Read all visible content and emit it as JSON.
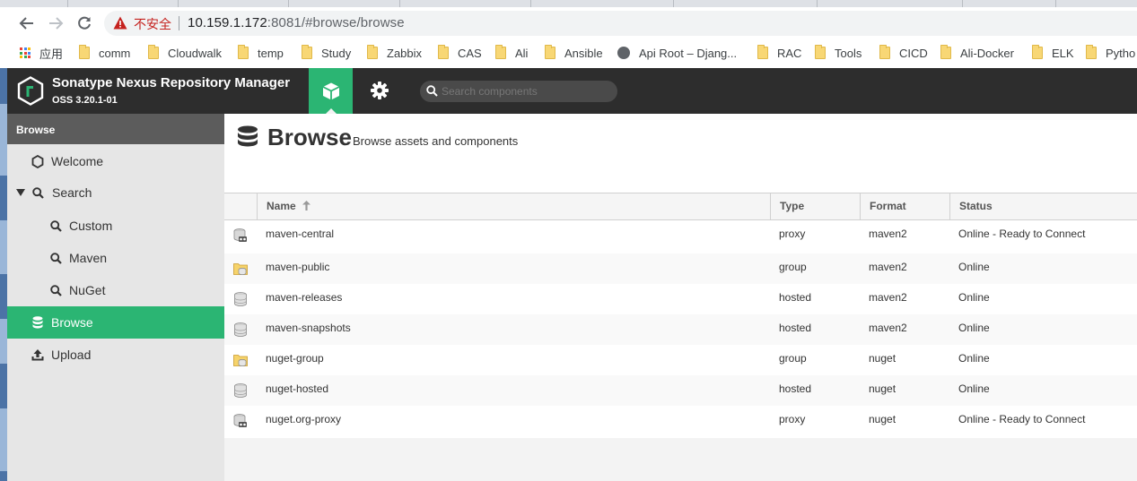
{
  "browser": {
    "address_security": "不安全",
    "url_host": "10.159.1.172",
    "url_rest": ":8081/#browse/browse",
    "bookmarks": [
      "应用",
      "comm",
      "Cloudwalk",
      "temp",
      "Study",
      "Zabbix",
      "CAS",
      "Ali",
      "Ansible",
      "Api Root – Djang...",
      "RAC",
      "Tools",
      "CICD",
      "Ali-Docker",
      "ELK",
      "Pytho"
    ]
  },
  "header": {
    "title": "Sonatype Nexus Repository Manager",
    "version": "OSS 3.20.1-01",
    "search_placeholder": "Search components",
    "accent": "#2bb573"
  },
  "sidebar": {
    "heading": "Browse",
    "items": [
      {
        "label": "Welcome",
        "icon": "hexagon-icon"
      },
      {
        "label": "Search",
        "icon": "search-icon",
        "expanded": true
      },
      {
        "label": "Custom",
        "icon": "search-icon"
      },
      {
        "label": "Maven",
        "icon": "search-icon"
      },
      {
        "label": "NuGet",
        "icon": "search-icon"
      },
      {
        "label": "Browse",
        "icon": "database-icon",
        "active": true
      },
      {
        "label": "Upload",
        "icon": "upload-icon"
      }
    ]
  },
  "page": {
    "title": "Browse",
    "subtitle": "Browse assets and components"
  },
  "table": {
    "columns": [
      "Name",
      "Type",
      "Format",
      "Status"
    ],
    "sort_column": "Name",
    "sort_direction": "ascending",
    "rows": [
      {
        "name": "maven-central",
        "type": "proxy",
        "format": "maven2",
        "status": "Online - Ready to Connect"
      },
      {
        "name": "maven-public",
        "type": "group",
        "format": "maven2",
        "status": "Online"
      },
      {
        "name": "maven-releases",
        "type": "hosted",
        "format": "maven2",
        "status": "Online"
      },
      {
        "name": "maven-snapshots",
        "type": "hosted",
        "format": "maven2",
        "status": "Online"
      },
      {
        "name": "nuget-group",
        "type": "group",
        "format": "nuget",
        "status": "Online"
      },
      {
        "name": "nuget-hosted",
        "type": "hosted",
        "format": "nuget",
        "status": "Online"
      },
      {
        "name": "nuget.org-proxy",
        "type": "proxy",
        "format": "nuget",
        "status": "Online - Ready to Connect"
      }
    ]
  }
}
